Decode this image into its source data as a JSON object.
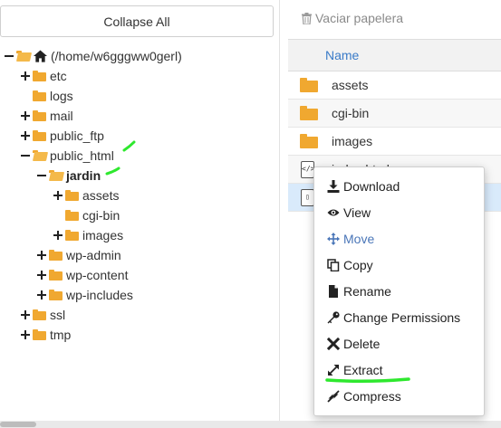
{
  "left_panel": {
    "collapse_label": "Collapse All",
    "tree": [
      {
        "label": "(/home/w6gggww0gerl)",
        "expanded": true,
        "icon": "home-icon"
      },
      {
        "label": "etc",
        "expanded": false
      },
      {
        "label": "logs",
        "expanded": null
      },
      {
        "label": "mail",
        "expanded": false
      },
      {
        "label": "public_ftp",
        "expanded": false
      },
      {
        "label": "public_html",
        "expanded": true
      },
      {
        "label": "jardin",
        "expanded": true,
        "bold": true
      },
      {
        "label": "assets",
        "expanded": false
      },
      {
        "label": "cgi-bin",
        "expanded": null
      },
      {
        "label": "images",
        "expanded": false
      },
      {
        "label": "wp-admin",
        "expanded": false
      },
      {
        "label": "wp-content",
        "expanded": false
      },
      {
        "label": "wp-includes",
        "expanded": false
      },
      {
        "label": "ssl",
        "expanded": false
      },
      {
        "label": "tmp",
        "expanded": false
      }
    ]
  },
  "right_panel": {
    "trash_label": "Vaciar papelera",
    "column_name": "Name",
    "files": [
      {
        "name": "assets",
        "type": "folder"
      },
      {
        "name": "cgi-bin",
        "type": "folder"
      },
      {
        "name": "images",
        "type": "folder"
      },
      {
        "name": "index.html",
        "type": "html-file"
      },
      {
        "name": "",
        "type": "archive-file",
        "selected": true
      }
    ]
  },
  "context_menu": {
    "items": [
      {
        "label": "Download",
        "icon": "download-icon"
      },
      {
        "label": "View",
        "icon": "eye-icon"
      },
      {
        "label": "Move",
        "icon": "move-icon"
      },
      {
        "label": "Copy",
        "icon": "copy-icon"
      },
      {
        "label": "Rename",
        "icon": "file-icon"
      },
      {
        "label": "Change Permissions",
        "icon": "key-icon"
      },
      {
        "label": "Delete",
        "icon": "close-icon"
      },
      {
        "label": "Extract",
        "icon": "expand-icon"
      },
      {
        "label": "Compress",
        "icon": "compress-icon"
      }
    ]
  },
  "colors": {
    "folder": "#f0a830",
    "link_blue": "#3a7bc8",
    "highlight_green": "#2ee82e",
    "selected_row": "#d9eafb"
  }
}
